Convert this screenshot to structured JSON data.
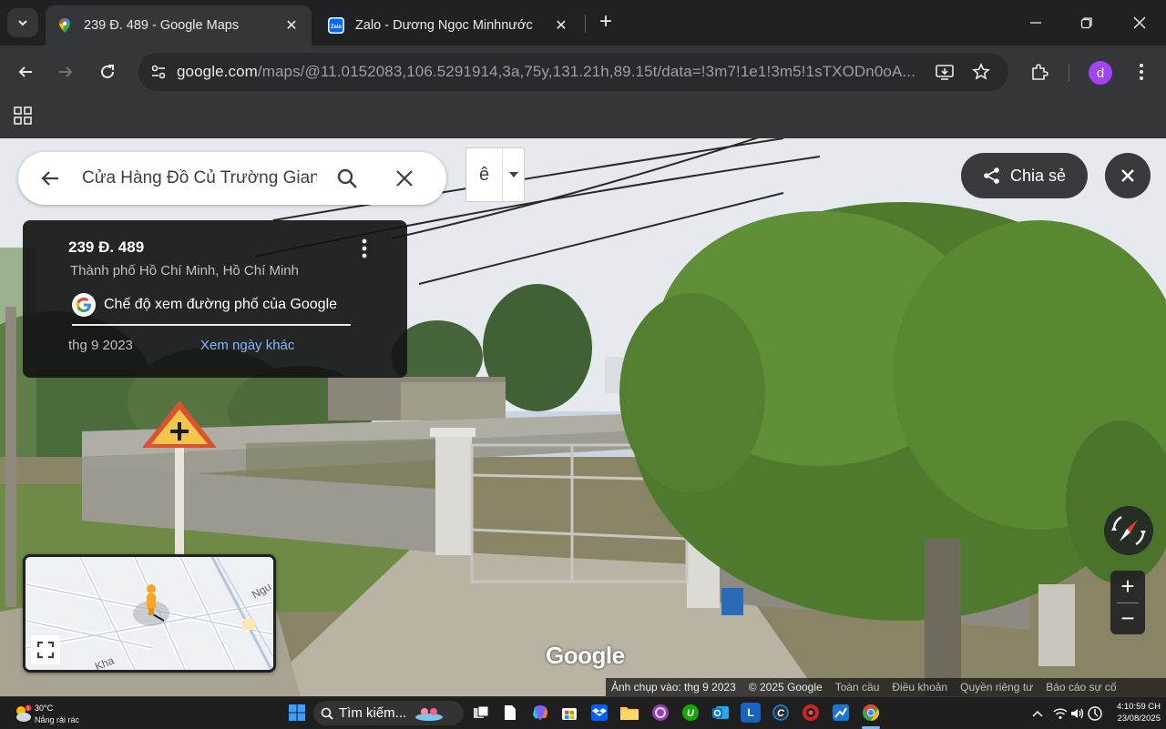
{
  "browser": {
    "tabs": [
      {
        "title": "239 Đ. 489 - Google Maps",
        "active": true
      },
      {
        "title": "Zalo - Dương Ngọc Minhnước",
        "active": false
      }
    ],
    "url_host": "google.com",
    "url_path": "/maps/@11.0152083,106.5291914,3a,75y,131.21h,89.15t/data=!3m7!1e1!3m5!1sTXODn0oA...",
    "profile_initial": "d"
  },
  "maps": {
    "search_query": "Cửa Hàng Đồ Củ Trường Giang",
    "ime_char": "ê",
    "share_label": "Chia sẻ",
    "info": {
      "address": "239 Đ. 489",
      "city": "Thành phố Hồ Chí Minh, Hồ Chí Minh",
      "streetview_label": "Chế độ xem đường phố của Google",
      "date": "thg 9 2023",
      "other_dates": "Xem ngày khác"
    },
    "minimap": {
      "road_label_1": "Ngu",
      "road_label_2": "Kha"
    },
    "watermark": "Google",
    "attribution": {
      "captured": "Ảnh chụp vào: thg 9 2023",
      "copyright": "© 2025 Google",
      "global": "Toàn cầu",
      "terms": "Điều khoản",
      "privacy": "Quyền riêng tư",
      "report": "Báo cáo sự cố"
    }
  },
  "taskbar": {
    "weather_temp": "30°C",
    "weather_cond": "Nắng rải rác",
    "search_placeholder": "Tìm kiếm...",
    "time": "4:10:59 CH",
    "date": "23/08/2025",
    "icons": [
      {
        "name": "windows-start-icon",
        "color": "#3aa0ff"
      },
      {
        "name": "task-view-icon",
        "color": "#cfd8dc"
      },
      {
        "name": "file-icon",
        "color": "#ffffff"
      },
      {
        "name": "copilot-icon",
        "color": "#7b61ff"
      },
      {
        "name": "microsoft-store-icon",
        "color": "#f25022"
      },
      {
        "name": "dropbox-icon",
        "color": "#0061ff"
      },
      {
        "name": "file-explorer-icon",
        "color": "#ffc83d"
      },
      {
        "name": "app-purple-icon",
        "color": "#8e44ad"
      },
      {
        "name": "upwork-icon",
        "color": "#14a800"
      },
      {
        "name": "outlook-icon",
        "color": "#0078d4"
      },
      {
        "name": "app-l-icon",
        "color": "#1565c0"
      },
      {
        "name": "app-c-icon",
        "color": "#1e88e5"
      },
      {
        "name": "app-red-icon",
        "color": "#c62828"
      },
      {
        "name": "app-chart-icon",
        "color": "#1976d2"
      },
      {
        "name": "chrome-icon",
        "color": "#34a853"
      }
    ]
  }
}
